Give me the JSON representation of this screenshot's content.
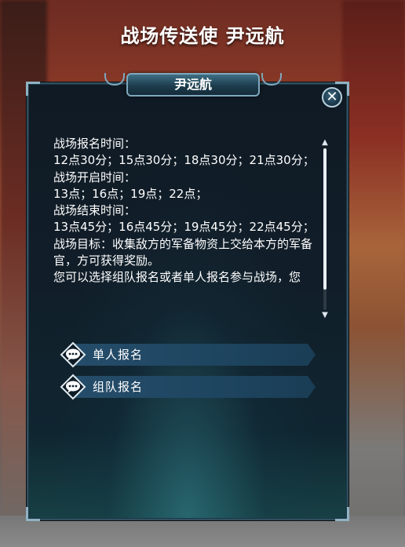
{
  "npc_header": "战场传送使  尹远航",
  "dialog": {
    "tab_title": "尹远航",
    "close_symbol": "✕",
    "text_lines": [
      "战场报名时间：",
      "12点30分；15点30分；18点30分；21点30分；",
      "战场开启时间：",
      "13点；16点；19点；22点；",
      "战场结束时间：",
      "13点45分；16点45分；19点45分；22点45分；",
      "战场目标：收集敌方的军备物资上交给本方的军备官，方可获得奖励。",
      "您可以选择组队报名或者单人报名参与战场，您"
    ],
    "options": [
      {
        "label": "单人报名",
        "icon": "chat-bubble-icon"
      },
      {
        "label": "组队报名",
        "icon": "chat-bubble-icon"
      }
    ],
    "scroll_up": "▲",
    "scroll_down": "▼"
  },
  "colors": {
    "panel_bg": "#0f1a24",
    "option_bar": "#254d6a",
    "accent_border": "#7fa8bd"
  }
}
